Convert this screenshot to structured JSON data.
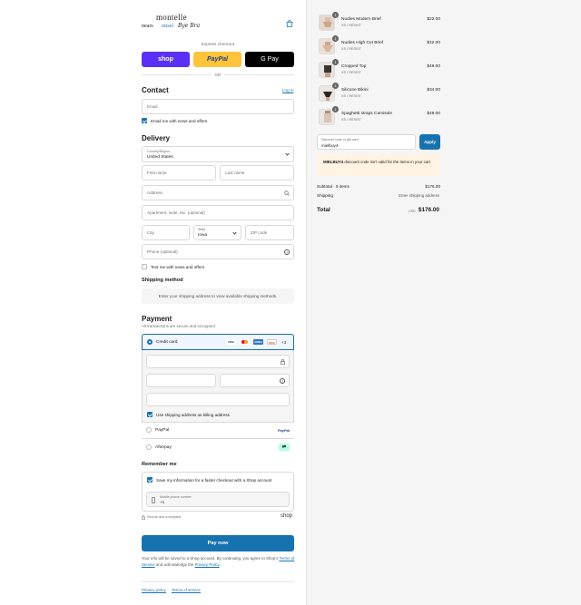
{
  "brand": {
    "logo_top": "montelle",
    "logo_sub": "nears",
    "logo_mid": "misel",
    "logo_script": "Bye Bra"
  },
  "express": {
    "heading": "Express checkout",
    "shop_label": "shop",
    "paypal_label": "PayPal",
    "gpay_label": "G Pay",
    "or_label": "OR"
  },
  "contact": {
    "heading": "Contact",
    "login_link": "Log in",
    "email_placeholder": "Email",
    "news_label": "Email me with news and offers"
  },
  "delivery": {
    "heading": "Delivery",
    "country_label": "Country/Region",
    "country_value": "United States",
    "first_name": "First name",
    "last_name": "Last name",
    "address": "Address",
    "apartment": "Apartment, suite, etc. (optional)",
    "city": "City",
    "state_label": "State",
    "state_value": "Iowa",
    "zip": "ZIP code",
    "phone": "Phone (optional)",
    "text_label": "Text me with news and offers"
  },
  "shipping": {
    "heading": "Shipping method",
    "info": "Enter your shipping address to view available shipping methods."
  },
  "payment": {
    "heading": "Payment",
    "secure_note": "All transactions are secure and encrypted.",
    "credit_card": "Credit card",
    "more_cards": "+3",
    "card_brands": [
      "VISA",
      "MC",
      "AMEX",
      "DISC"
    ],
    "billing_label": "Use shipping address as billing address",
    "paypal": "PayPal",
    "paypal_logo": "PayPal",
    "afterpay": "Afterpay"
  },
  "remember": {
    "heading": "Remember me",
    "save_label": "Save my information for a faster checkout with a Shop account",
    "mobile_label": "Mobile phone number",
    "mobile_value": "+1",
    "secure_label": "Secure and encrypted",
    "shop_logo": "shop"
  },
  "pay_button": "Pay now",
  "legal": {
    "text1": "Your info will be saved to a Shop account. By continuing, you agree to Shop's",
    "tos": "Terms of Service",
    "text2": "and acknowledge the",
    "privacy": "Privacy Policy",
    "end": "."
  },
  "footer": {
    "privacy": "Privacy policy",
    "terms": "Terms of service"
  },
  "cart": {
    "items": [
      {
        "qty": "1",
        "name": "Nudies Modern Brief",
        "variant": "XS / RESIST",
        "price": "$22.00"
      },
      {
        "qty": "1",
        "name": "Nudies High Cut Brief",
        "variant": "XS / RESIST",
        "price": "$22.00"
      },
      {
        "qty": "1",
        "name": "Cropped Top",
        "variant": "XS / RESIST",
        "price": "$49.00"
      },
      {
        "qty": "1",
        "name": "Silicone Bikini",
        "variant": "XS / RESIST",
        "price": "$34.00"
      },
      {
        "qty": "1",
        "name": "Spaghetti straps Camisole",
        "variant": "XS / RESIST",
        "price": "$49.00"
      }
    ],
    "discount_label": "Discount code or gift card",
    "discount_value": "mielbuy4",
    "apply": "Apply",
    "error_code": "MIELBUY4",
    "error_text": " discount code isn't valid for the items in your cart",
    "subtotal_label": "Subtotal · 5 items",
    "subtotal_value": "$176.00",
    "shipping_label": "Shipping",
    "shipping_value": "Enter shipping address",
    "total_label": "Total",
    "currency": "USD",
    "total_value": "$176.00"
  },
  "colors": {
    "accent": "#1773b0",
    "shop_purple": "#5a31f4",
    "paypal_yellow": "#ffc439",
    "pay_button": "#1773b0",
    "error_bg": "#fff3e3"
  }
}
